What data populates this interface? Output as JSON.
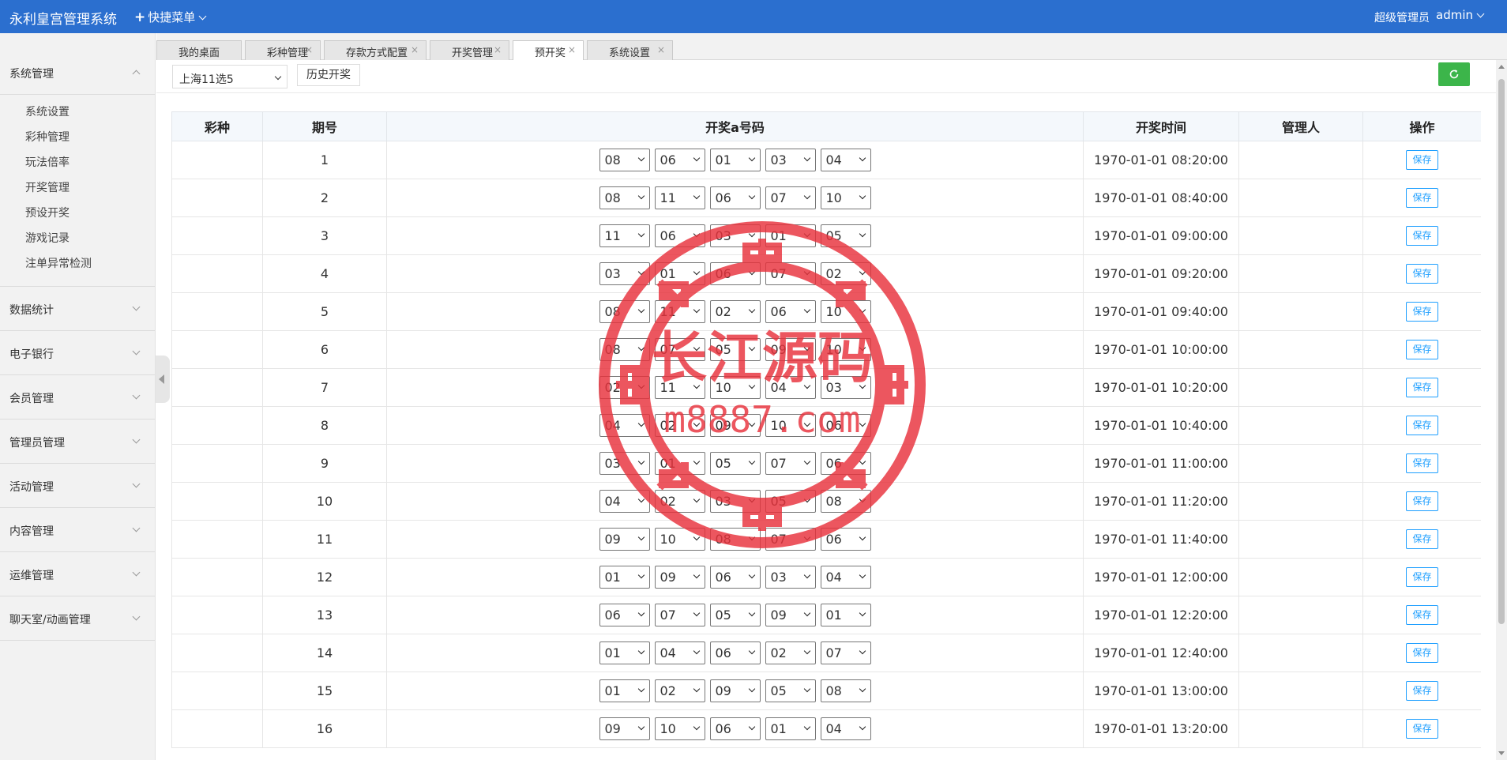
{
  "app": {
    "title": "永利皇宫管理系统",
    "quick_menu": "快捷菜单"
  },
  "user": {
    "role": "超级管理员",
    "name": "admin"
  },
  "sidebar": {
    "open_group": "系统管理",
    "sub_items": [
      "系统设置",
      "彩种管理",
      "玩法倍率",
      "开奖管理",
      "预设开奖",
      "游戏记录",
      "注单异常检测"
    ],
    "groups": [
      "数据统计",
      "电子银行",
      "会员管理",
      "管理员管理",
      "活动管理",
      "内容管理",
      "运维管理",
      "聊天室/动画管理"
    ]
  },
  "tabs": [
    "我的桌面",
    "彩种管理",
    "存款方式配置",
    "开奖管理",
    "预开奖",
    "系统设置"
  ],
  "active_tab": "预开奖",
  "toolbar": {
    "lottery": "上海11选5",
    "history_button": "历史开奖"
  },
  "table": {
    "headers": [
      "彩种",
      "期号",
      "开奖a号码",
      "开奖时间",
      "管理人",
      "操作"
    ],
    "save_label": "保存",
    "rows": [
      {
        "issue": "1",
        "numbers": [
          "08",
          "06",
          "01",
          "03",
          "04"
        ],
        "time": "1970-01-01 08:20:00"
      },
      {
        "issue": "2",
        "numbers": [
          "08",
          "11",
          "06",
          "07",
          "10"
        ],
        "time": "1970-01-01 08:40:00"
      },
      {
        "issue": "3",
        "numbers": [
          "11",
          "06",
          "03",
          "01",
          "05"
        ],
        "time": "1970-01-01 09:00:00"
      },
      {
        "issue": "4",
        "numbers": [
          "03",
          "01",
          "06",
          "07",
          "02"
        ],
        "time": "1970-01-01 09:20:00"
      },
      {
        "issue": "5",
        "numbers": [
          "08",
          "11",
          "02",
          "06",
          "10"
        ],
        "time": "1970-01-01 09:40:00"
      },
      {
        "issue": "6",
        "numbers": [
          "08",
          "07",
          "05",
          "09",
          "10"
        ],
        "time": "1970-01-01 10:00:00"
      },
      {
        "issue": "7",
        "numbers": [
          "02",
          "11",
          "10",
          "04",
          "03"
        ],
        "time": "1970-01-01 10:20:00"
      },
      {
        "issue": "8",
        "numbers": [
          "04",
          "02",
          "09",
          "10",
          "06"
        ],
        "time": "1970-01-01 10:40:00"
      },
      {
        "issue": "9",
        "numbers": [
          "03",
          "01",
          "05",
          "07",
          "06"
        ],
        "time": "1970-01-01 11:00:00"
      },
      {
        "issue": "10",
        "numbers": [
          "04",
          "02",
          "03",
          "05",
          "08"
        ],
        "time": "1970-01-01 11:20:00"
      },
      {
        "issue": "11",
        "numbers": [
          "09",
          "10",
          "08",
          "07",
          "06"
        ],
        "time": "1970-01-01 11:40:00"
      },
      {
        "issue": "12",
        "numbers": [
          "01",
          "09",
          "06",
          "03",
          "04"
        ],
        "time": "1970-01-01 12:00:00"
      },
      {
        "issue": "13",
        "numbers": [
          "06",
          "07",
          "05",
          "09",
          "01"
        ],
        "time": "1970-01-01 12:20:00"
      },
      {
        "issue": "14",
        "numbers": [
          "01",
          "04",
          "06",
          "02",
          "07"
        ],
        "time": "1970-01-01 12:40:00"
      },
      {
        "issue": "15",
        "numbers": [
          "01",
          "02",
          "09",
          "05",
          "08"
        ],
        "time": "1970-01-01 13:00:00"
      },
      {
        "issue": "16",
        "numbers": [
          "09",
          "10",
          "06",
          "01",
          "04"
        ],
        "time": "1970-01-01 13:20:00"
      }
    ]
  },
  "watermark": {
    "line1": "长江源码",
    "line2": "m8887.com",
    "color": "#e8323c"
  },
  "colors": {
    "topbar": "#2b6fcf",
    "refresh": "#3cb54a",
    "save": "#1e9fff"
  }
}
